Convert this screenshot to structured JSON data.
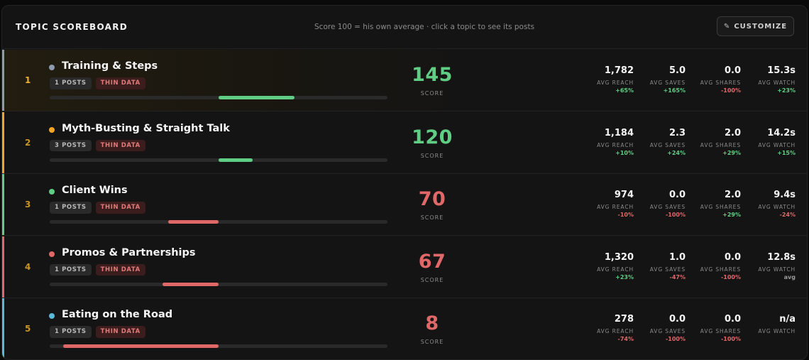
{
  "header": {
    "title": "TOPIC SCOREBOARD",
    "subtitle": "Score 100 = his own average · click a topic to see its posts",
    "customize_label": "CUSTOMIZE"
  },
  "metric_labels": {
    "reach": "AVG REACH",
    "saves": "AVG SAVES",
    "shares": "AVG SHARES",
    "watch": "AVG WATCH"
  },
  "score_label": "SCORE",
  "thin_label": "THIN DATA",
  "colors": {
    "green": "#5fce84",
    "red": "#e06868",
    "rank": "#c8942b"
  },
  "topics": [
    {
      "rank": "1",
      "name": "Training & Steps",
      "dot_color": "#8e9aad",
      "posts": "1 POSTS",
      "score": "145",
      "score_color": "#5fce84",
      "bar_start": 0.5,
      "bar_end": 0.725,
      "bar_color": "#5fce84",
      "reach": "1,782",
      "reach_delta": "+65%",
      "reach_tone": "pos",
      "saves": "5.0",
      "saves_delta": "+165%",
      "saves_tone": "pos",
      "shares": "0.0",
      "shares_delta": "-100%",
      "shares_tone": "neg",
      "watch": "15.3s",
      "watch_delta": "+23%",
      "watch_tone": "pos"
    },
    {
      "rank": "2",
      "name": "Myth-Busting & Straight Talk",
      "dot_color": "#f5a524",
      "posts": "3 POSTS",
      "score": "120",
      "score_color": "#5fce84",
      "bar_start": 0.5,
      "bar_end": 0.6,
      "bar_color": "#5fce84",
      "reach": "1,184",
      "reach_delta": "+10%",
      "reach_tone": "pos",
      "saves": "2.3",
      "saves_delta": "+24%",
      "saves_tone": "pos",
      "shares": "2.0",
      "shares_delta": "+29%",
      "shares_tone": "pos",
      "watch": "14.2s",
      "watch_delta": "+15%",
      "watch_tone": "pos"
    },
    {
      "rank": "3",
      "name": "Client Wins",
      "dot_color": "#5fce84",
      "posts": "1 POSTS",
      "score": "70",
      "score_color": "#e06868",
      "bar_start": 0.35,
      "bar_end": 0.5,
      "bar_color": "#e06868",
      "reach": "974",
      "reach_delta": "-10%",
      "reach_tone": "neg",
      "saves": "0.0",
      "saves_delta": "-100%",
      "saves_tone": "neg",
      "shares": "2.0",
      "shares_delta": "+29%",
      "shares_tone": "pos",
      "watch": "9.4s",
      "watch_delta": "-24%",
      "watch_tone": "neg"
    },
    {
      "rank": "4",
      "name": "Promos & Partnerships",
      "dot_color": "#e06868",
      "posts": "1 POSTS",
      "score": "67",
      "score_color": "#e06868",
      "bar_start": 0.335,
      "bar_end": 0.5,
      "bar_color": "#e06868",
      "reach": "1,320",
      "reach_delta": "+23%",
      "reach_tone": "pos",
      "saves": "1.0",
      "saves_delta": "-47%",
      "saves_tone": "neg",
      "shares": "0.0",
      "shares_delta": "-100%",
      "shares_tone": "neg",
      "watch": "12.8s",
      "watch_delta": "avg",
      "watch_tone": "neu"
    },
    {
      "rank": "5",
      "name": "Eating on the Road",
      "dot_color": "#5ab8d8",
      "posts": "1 POSTS",
      "score": "8",
      "score_color": "#e06868",
      "bar_start": 0.04,
      "bar_end": 0.5,
      "bar_color": "#e06868",
      "reach": "278",
      "reach_delta": "-74%",
      "reach_tone": "neg",
      "saves": "0.0",
      "saves_delta": "-100%",
      "saves_tone": "neg",
      "shares": "0.0",
      "shares_delta": "-100%",
      "shares_tone": "neg",
      "watch": "n/a",
      "watch_delta": "",
      "watch_tone": "neu"
    }
  ]
}
